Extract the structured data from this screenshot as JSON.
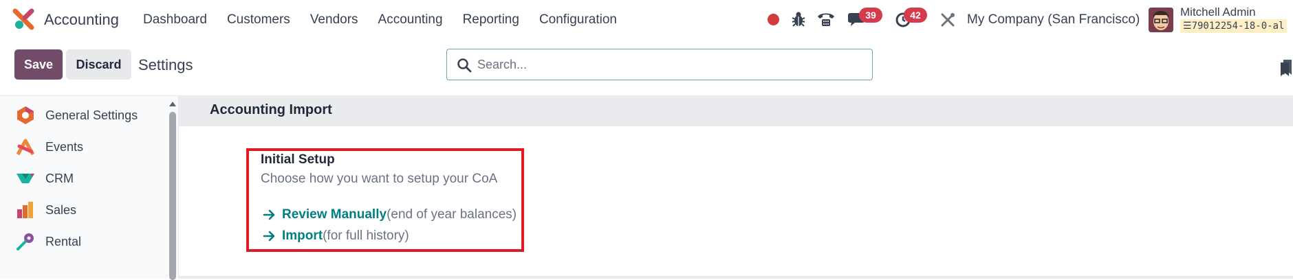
{
  "navbar": {
    "app_name": "Accounting",
    "menu": [
      "Dashboard",
      "Customers",
      "Vendors",
      "Accounting",
      "Reporting",
      "Configuration"
    ],
    "messages_count": "39",
    "activities_count": "42",
    "company": "My Company (San Francisco)",
    "user_name": "Mitchell Admin",
    "database": "79012254-18-0-al",
    "icons": [
      "app-logo-icon",
      "recording-dot-icon",
      "bug-icon",
      "phone-icon",
      "chat-icon",
      "clock-icon",
      "tools-icon",
      "database-icon",
      "avatar"
    ]
  },
  "control": {
    "save_label": "Save",
    "discard_label": "Discard",
    "breadcrumb": "Settings",
    "search_placeholder": "Search..."
  },
  "sidebar": {
    "items": [
      {
        "label": "General Settings",
        "icon": "general-settings-icon"
      },
      {
        "label": "Events",
        "icon": "events-icon"
      },
      {
        "label": "CRM",
        "icon": "crm-icon"
      },
      {
        "label": "Sales",
        "icon": "sales-icon"
      },
      {
        "label": "Rental",
        "icon": "rental-icon"
      }
    ]
  },
  "main": {
    "section_title": "Accounting Import",
    "setting": {
      "title": "Initial Setup",
      "description": "Choose how you want to setup your CoA",
      "links": [
        {
          "label": "Review Manually",
          "note": "(end of year balances)"
        },
        {
          "label": "Import",
          "note": "(for full history)"
        }
      ]
    }
  },
  "colors": {
    "primary": "#714b67",
    "link": "#017e84",
    "highlight": "#e01a24",
    "badge": "#d63b4b"
  }
}
